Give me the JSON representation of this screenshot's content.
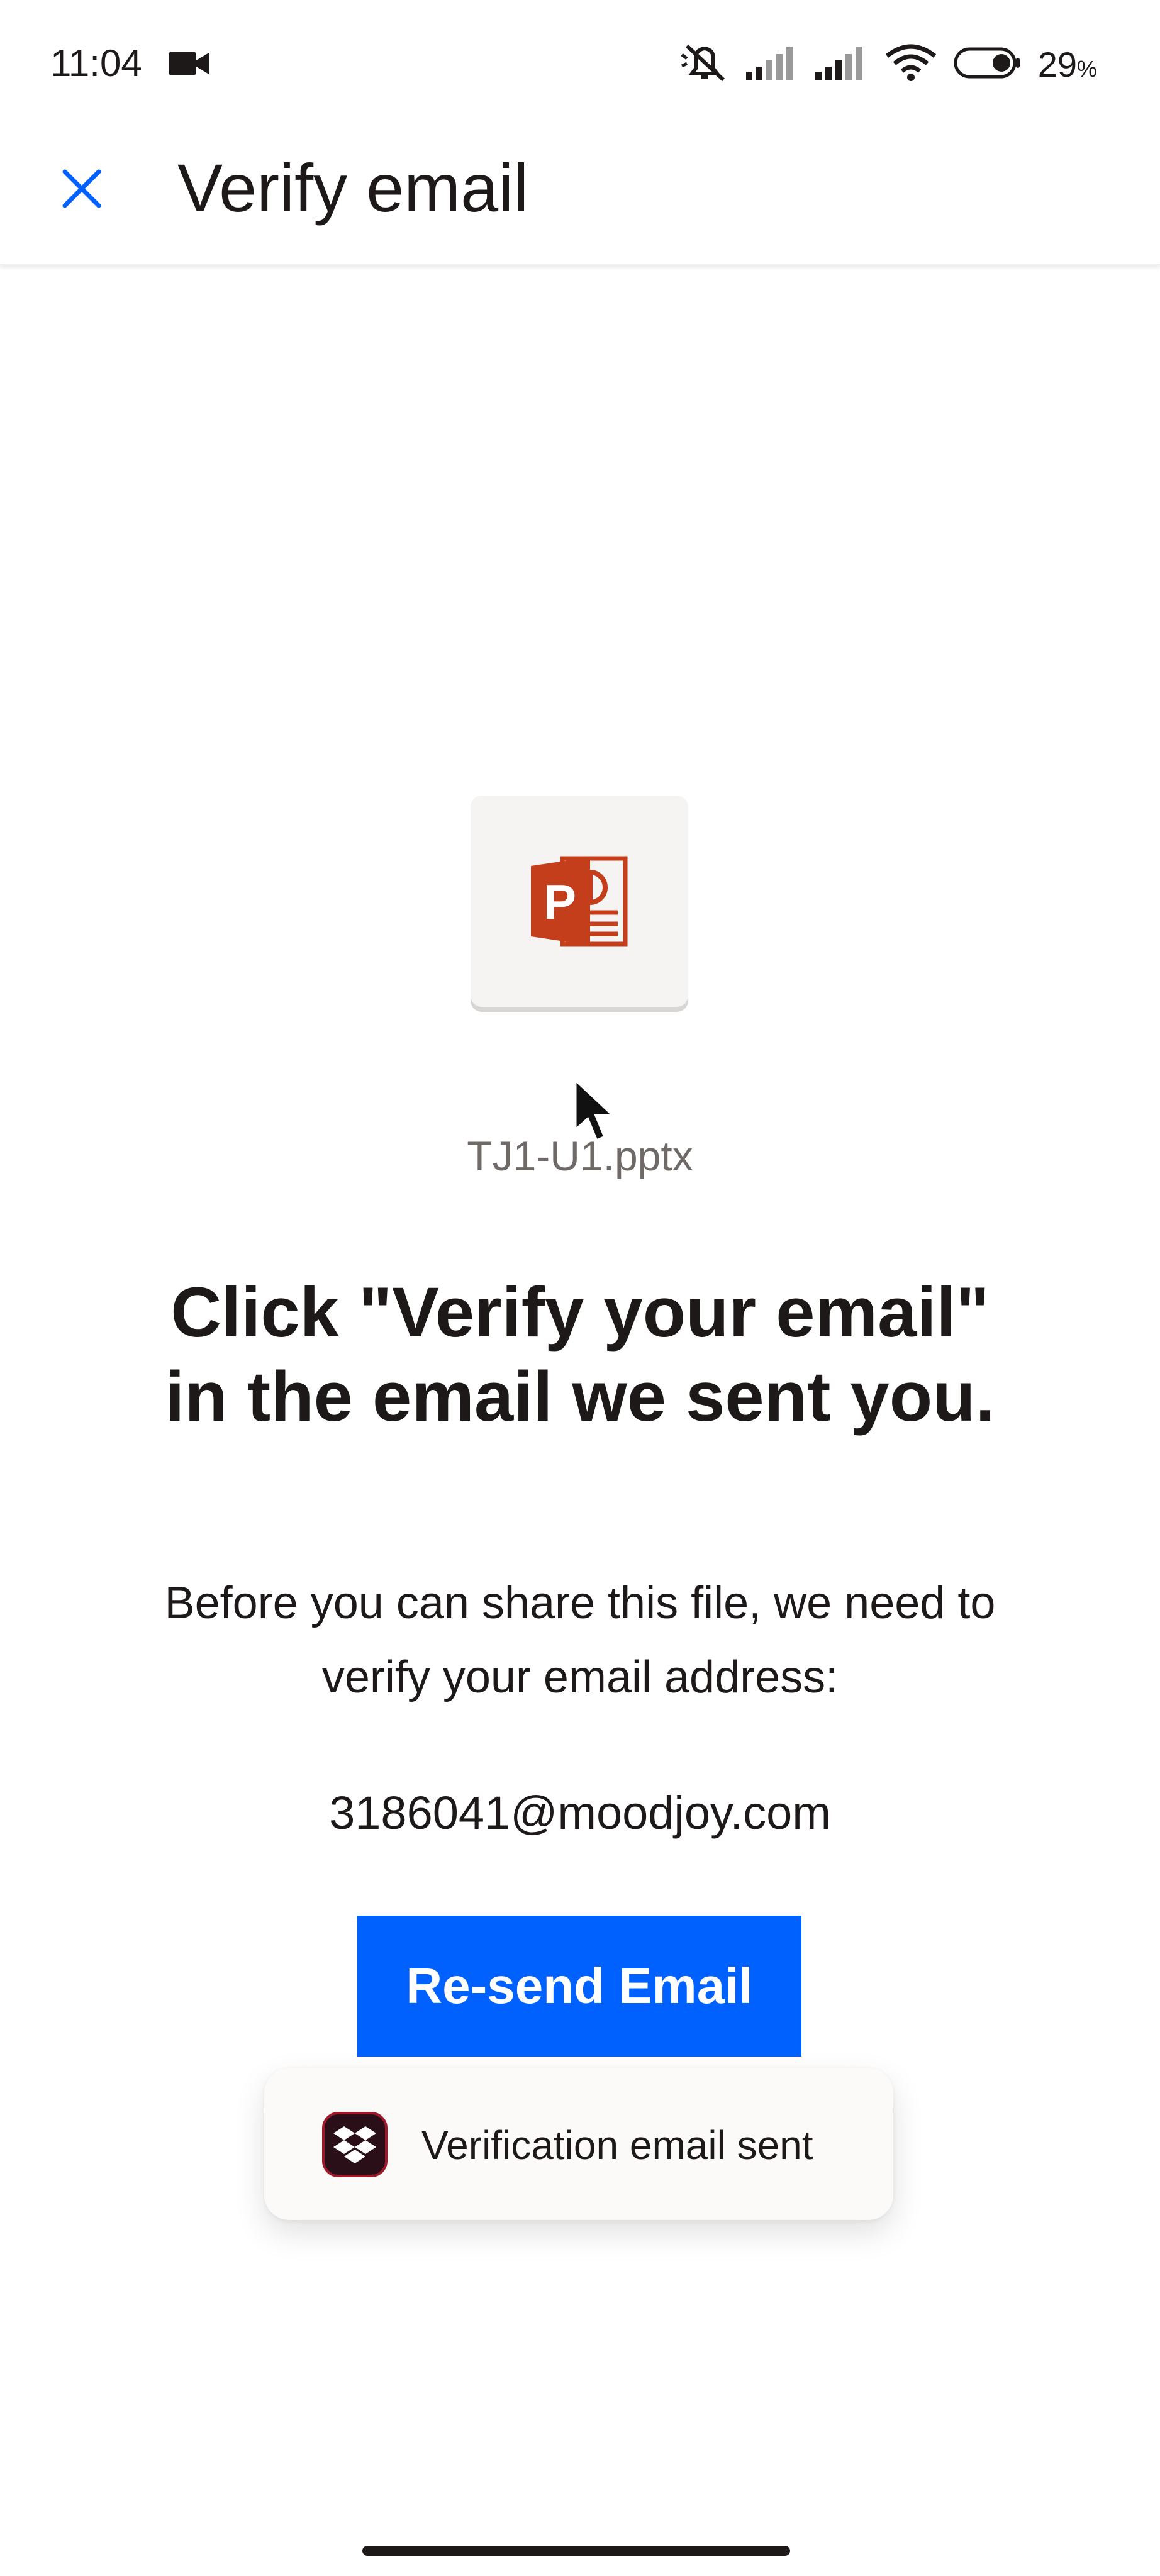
{
  "status_bar": {
    "time": "11:04",
    "battery_percent": "29",
    "battery_unit": "%",
    "icons": [
      "camera-icon",
      "mute-icon",
      "signal-icon",
      "signal-icon",
      "wifi-icon",
      "battery-icon"
    ]
  },
  "app_bar": {
    "title": "Verify email",
    "close_icon": "close-icon"
  },
  "file": {
    "name": "TJ1-U1.pptx",
    "icon": "powerpoint-icon"
  },
  "content": {
    "headline": "Click \"Verify your email\" in the email we sent you.",
    "body": "Before you can share this file, we need to verify your email address:",
    "email": "3186041@moodjoy.com"
  },
  "actions": {
    "resend_label": "Re-send Email"
  },
  "toast": {
    "message": "Verification email sent",
    "icon": "dropbox-icon"
  },
  "colors": {
    "accent": "#0061fe",
    "text": "#1e1919",
    "muted": "#6f6a67",
    "powerpoint": "#c43e1c"
  }
}
